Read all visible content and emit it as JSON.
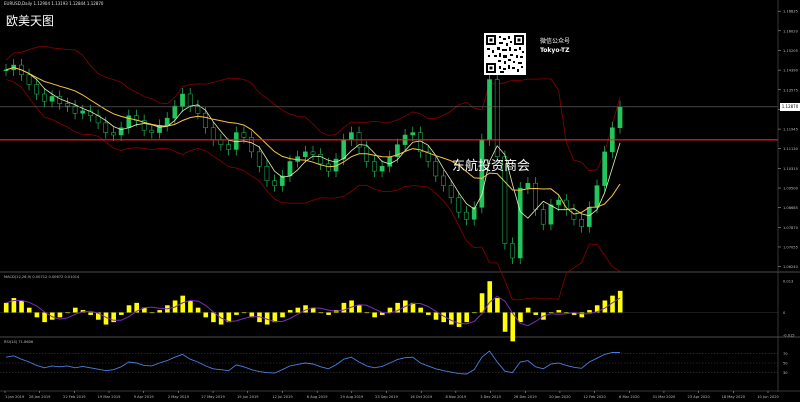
{
  "window": {
    "symbol_label": "EURUSD,Daily 1.12904 1.13193 1.12844 1.12870",
    "close_price_tag": "1.12870"
  },
  "watermarks": {
    "top_left": "欧美天图",
    "center": "东航投资商会",
    "qr_caption_1": "微信公众号",
    "qr_caption_2": "Tokyo-TZ"
  },
  "colors": {
    "background": "#000000",
    "candle_bull": "#22c55e",
    "ma_fast": "#e8f0b0",
    "ma_slow": "#f5c542",
    "envelope": "#8b0000",
    "hline": "#ff2020",
    "macd_hist": "#ffff00",
    "macd_signal": "#7b2cbf",
    "rsi": "#4a7fe0",
    "grid": "#5a5a5a",
    "axis_text": "#bfbfbf"
  },
  "chart_data": [
    {
      "type": "line",
      "panel": "price",
      "symbol": "EURUSD",
      "timeframe": "Daily",
      "y_axis_ticks": [
        1.16835,
        1.1602,
        1.15205,
        1.1439,
        1.13575,
        1.1276,
        1.11945,
        1.1113,
        1.10315,
        1.095,
        1.08685,
        1.0787,
        1.07055,
        1.0624
      ],
      "ylim": [
        1.061,
        1.1705
      ],
      "x_tick_labels": [
        "1 Jan 2019",
        "28 Jan 2019",
        "22 Feb 2019",
        "19 Mar 2019",
        "9 Apr 2019",
        "2 May 2019",
        "27 May 2019",
        "19 Jun 2019",
        "12 Jul 2019",
        "6 Aug 2019",
        "29 Aug 2019",
        "23 Sep 2019",
        "16 Oct 2019",
        "8 Nov 2019",
        "3 Dec 2019",
        "26 Dec 2019",
        "20 Jan 2020",
        "12 Feb 2020",
        "6 Mar 2020",
        "31 Mar 2020",
        "23 Apr 2020",
        "18 May 2020",
        "10 Jun 2020"
      ],
      "close_estimate": [
        1.144,
        1.146,
        1.142,
        1.138,
        1.134,
        1.131,
        1.133,
        1.13,
        1.129,
        1.126,
        1.127,
        1.125,
        1.122,
        1.118,
        1.117,
        1.12,
        1.125,
        1.123,
        1.119,
        1.118,
        1.121,
        1.124,
        1.129,
        1.134,
        1.129,
        1.126,
        1.12,
        1.115,
        1.113,
        1.111,
        1.118,
        1.116,
        1.11,
        1.104,
        1.098,
        1.096,
        1.1,
        1.106,
        1.108,
        1.11,
        1.109,
        1.105,
        1.102,
        1.107,
        1.115,
        1.118,
        1.112,
        1.106,
        1.102,
        1.104,
        1.108,
        1.113,
        1.117,
        1.118,
        1.11,
        1.106,
        1.1,
        1.096,
        1.091,
        1.085,
        1.082,
        1.087,
        1.115,
        1.14,
        1.108,
        1.072,
        1.066,
        1.095,
        1.097,
        1.086,
        1.08,
        1.088,
        1.09,
        1.086,
        1.082,
        1.079,
        1.087,
        1.096,
        1.11,
        1.12,
        1.1287
      ],
      "horizontal_line": 1.115
    },
    {
      "type": "bar",
      "panel": "MACD",
      "label": "MACD(12,26,9) 0.00712 0.00672 0.01014",
      "y_axis_ticks": [
        0.013,
        0.0,
        -0.015
      ],
      "histogram_estimate": [
        0.004,
        0.006,
        0.005,
        0.002,
        -0.002,
        -0.004,
        -0.003,
        -0.002,
        0.0,
        0.002,
        0.001,
        -0.001,
        -0.003,
        -0.005,
        -0.004,
        -0.001,
        0.003,
        0.004,
        0.002,
        0.0,
        0.001,
        0.003,
        0.005,
        0.007,
        0.005,
        0.002,
        -0.002,
        -0.004,
        -0.005,
        -0.004,
        -0.001,
        0.0,
        -0.002,
        -0.004,
        -0.005,
        -0.004,
        -0.002,
        0.001,
        0.002,
        0.003,
        0.002,
        0.0,
        -0.001,
        0.001,
        0.004,
        0.005,
        0.003,
        0.0,
        -0.002,
        -0.001,
        0.002,
        0.004,
        0.005,
        0.004,
        0.002,
        -0.001,
        -0.003,
        -0.004,
        -0.005,
        -0.006,
        -0.004,
        0.0,
        0.008,
        0.013,
        0.006,
        -0.008,
        -0.012,
        -0.004,
        0.002,
        -0.001,
        -0.003,
        0.0,
        0.001,
        0.0,
        -0.001,
        -0.002,
        0.001,
        0.003,
        0.005,
        0.007,
        0.009
      ]
    },
    {
      "type": "line",
      "panel": "RSI",
      "label": "RSI(14) 71.8606",
      "y_axis_ticks": [
        70,
        50,
        30
      ],
      "ylim": [
        0,
        100
      ],
      "values_estimate": [
        62,
        65,
        58,
        52,
        45,
        40,
        44,
        42,
        44,
        40,
        43,
        40,
        37,
        34,
        36,
        42,
        52,
        50,
        45,
        44,
        50,
        55,
        62,
        68,
        58,
        52,
        44,
        38,
        36,
        34,
        46,
        42,
        36,
        32,
        30,
        29,
        36,
        44,
        47,
        50,
        48,
        42,
        38,
        46,
        58,
        62,
        52,
        44,
        40,
        43,
        50,
        57,
        61,
        62,
        50,
        44,
        38,
        34,
        31,
        28,
        27,
        36,
        62,
        75,
        52,
        33,
        30,
        52,
        55,
        42,
        38,
        48,
        50,
        45,
        41,
        39,
        52,
        60,
        68,
        72,
        71.86
      ]
    }
  ]
}
